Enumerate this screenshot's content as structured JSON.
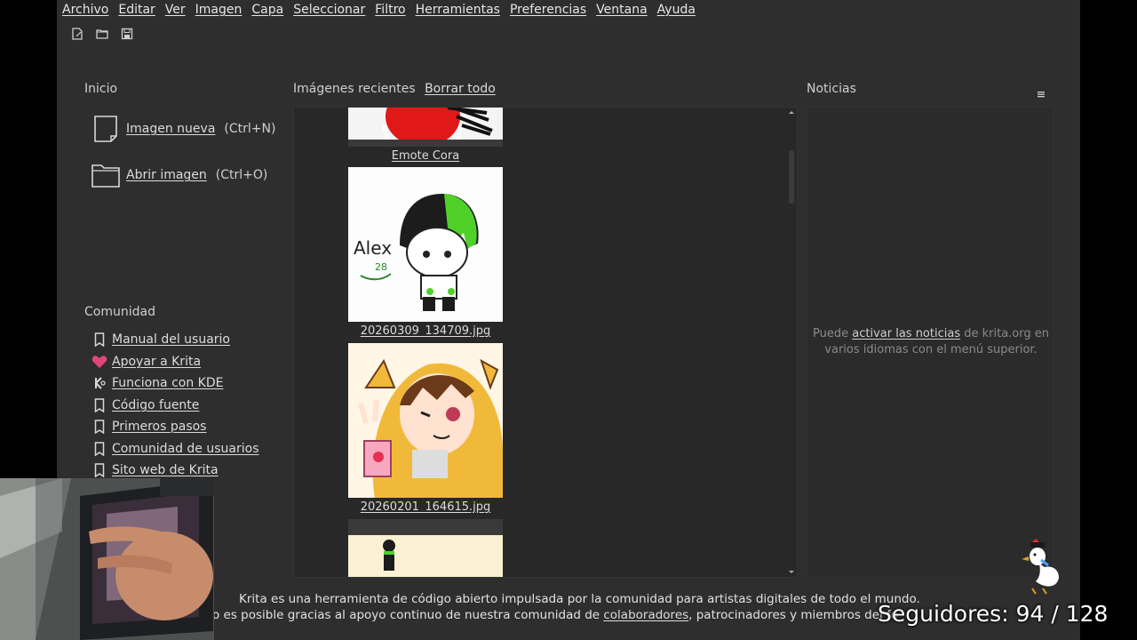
{
  "menubar": {
    "items": [
      "Archivo",
      "Editar",
      "Ver",
      "Imagen",
      "Capa",
      "Seleccionar",
      "Filtro",
      "Herramientas",
      "Preferencias",
      "Ventana",
      "Ayuda"
    ]
  },
  "toolbar": {
    "new_icon": "new-document-icon",
    "open_icon": "folder-icon",
    "save_icon": "save-icon"
  },
  "start": {
    "title": "Inicio",
    "new_image": {
      "label": "Imagen nueva",
      "shortcut": "(Ctrl+N)"
    },
    "open_image": {
      "label": "Abrir imagen",
      "shortcut": "(Ctrl+O)"
    }
  },
  "community": {
    "title": "Comunidad",
    "items": [
      {
        "label": "Manual del usuario",
        "icon": "bookmark-icon"
      },
      {
        "label": "Apoyar a Krita",
        "icon": "heart-icon"
      },
      {
        "label": "Funciona con KDE",
        "icon": "kde-icon"
      },
      {
        "label": "Código fuente",
        "icon": "bookmark-icon"
      },
      {
        "label": "Primeros pasos",
        "icon": "bookmark-icon"
      },
      {
        "label": "Comunidad de usuarios",
        "icon": "bookmark-icon"
      },
      {
        "label": "Sito web de Krita",
        "icon": "bookmark-icon"
      }
    ]
  },
  "recent": {
    "title": "Imágenes recientes",
    "clear_all": "Borrar todo",
    "files": [
      "Emote Cora",
      "20260309_134709.jpg",
      "20260201_164615.jpg"
    ]
  },
  "news": {
    "title": "Noticias",
    "text_before": "Puede ",
    "link": "activar las noticias",
    "text_after": " de krita.org en varios idiomas con el menú superior."
  },
  "footer": {
    "line1": "Krita es una herramienta de código abierto impulsada por la comunidad para artistas digitales de todo el mundo.",
    "line2_before": "o es posible gracias al apoyo continuo de nuestra comunidad de ",
    "line2_link": "colaboradores",
    "line2_after": ", patrocinadores y miembros del fo"
  },
  "overlay": {
    "followers": "Seguidores: 94 / 128"
  },
  "colors": {
    "background": "#2e2e2e",
    "heart": "#e0457a",
    "accent_green": "#5fd13a"
  }
}
